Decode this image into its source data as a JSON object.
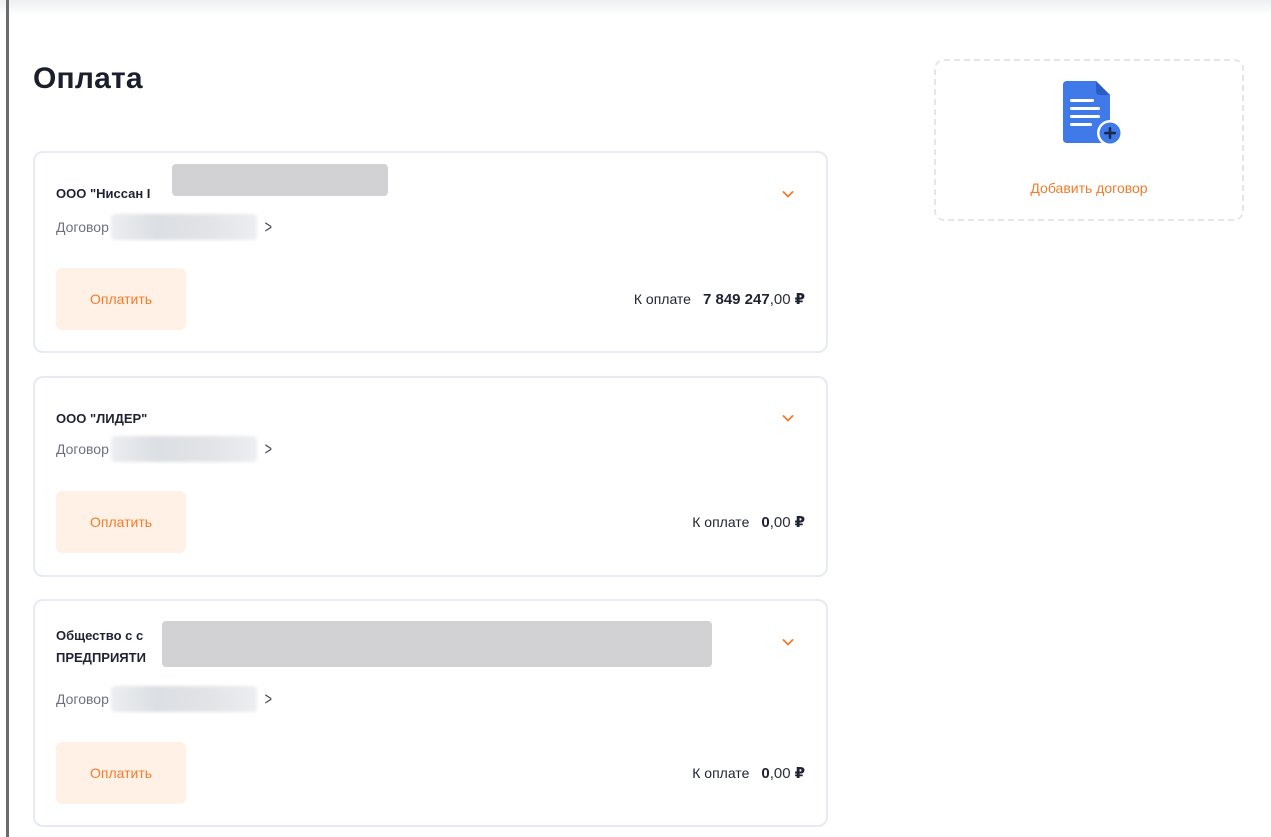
{
  "page": {
    "title": "Оплата"
  },
  "contracts": [
    {
      "company": "ООО \"Ниссан I",
      "contract_label": "Договор",
      "pay_label": "Оплатить",
      "amount_label": "К оплате",
      "amount_int": "7 849 247",
      "amount_dec": ",00",
      "currency": "₽"
    },
    {
      "company": "ООО \"ЛИДЕР\"",
      "contract_label": "Договор",
      "pay_label": "Оплатить",
      "amount_label": "К оплате",
      "amount_int": "0",
      "amount_dec": ",00",
      "currency": "₽"
    },
    {
      "company_line1": "Общество с с",
      "company_line2": "ПРЕДПРИЯТИ",
      "contract_label": "Договор",
      "pay_label": "Оплатить",
      "amount_label": "К оплате",
      "amount_int": "0",
      "amount_dec": ",00",
      "currency": "₽"
    }
  ],
  "add_contract": {
    "label": "Добавить договор"
  },
  "colors": {
    "accent": "#f07c2c",
    "button_bg": "#fff1e6",
    "icon_blue": "#3f7ae8",
    "card_border": "#e7eaf2"
  },
  "icons": [
    "chevron-down-icon",
    "chevron-right-icon",
    "document-add-icon"
  ]
}
